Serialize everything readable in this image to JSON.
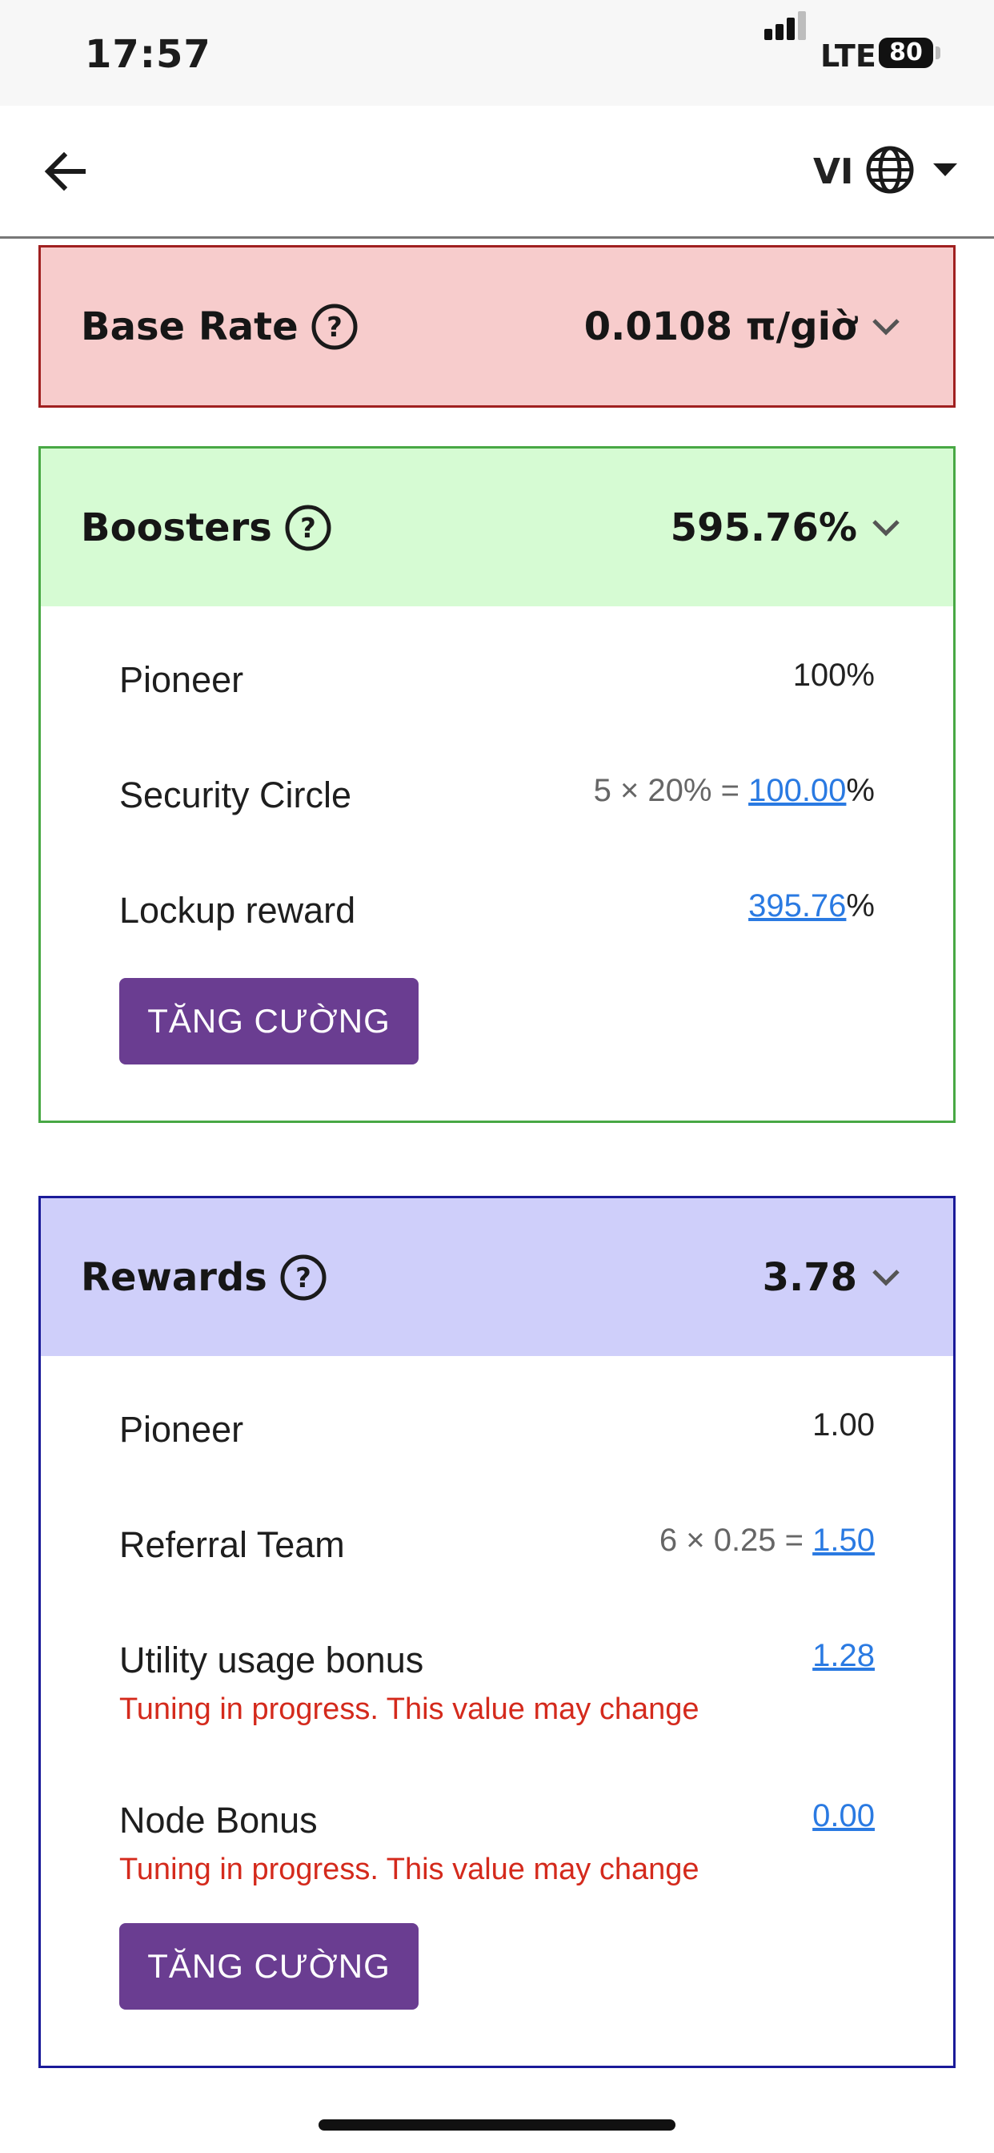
{
  "status_bar": {
    "time": "17:57",
    "network": "LTE",
    "battery": "80"
  },
  "top_nav": {
    "back_icon": "arrow-left-icon",
    "language_code": "VI",
    "language_icon": "globe-icon",
    "dropdown_icon": "caret-down-icon"
  },
  "base_rate": {
    "title": "Base Rate",
    "value": "0.0108 π/giờ",
    "bg_color": "#f7cccc",
    "border_color": "#a02020"
  },
  "boosters": {
    "title": "Boosters",
    "value": "595.76%",
    "bg_color": "#d6fbd3",
    "border_color": "#48a844",
    "rows": [
      {
        "label": "Pioneer",
        "formula": "",
        "link": "",
        "suffix": "100%"
      },
      {
        "label": "Security Circle",
        "formula": "5 × 20% = ",
        "link": "100.00",
        "suffix": "%"
      },
      {
        "label": "Lockup reward",
        "formula": "",
        "link": "395.76",
        "suffix": "%"
      }
    ],
    "button": "TĂNG CƯỜNG"
  },
  "rewards": {
    "title": "Rewards",
    "value": "3.78",
    "bg_color": "#cfcffa",
    "border_color": "#1a1a99",
    "rows": [
      {
        "label": "Pioneer",
        "formula": "",
        "link": "",
        "suffix": "1.00",
        "warning": ""
      },
      {
        "label": "Referral Team",
        "formula": "6 × 0.25 = ",
        "link": "1.50",
        "suffix": "",
        "warning": ""
      },
      {
        "label": "Utility usage bonus",
        "formula": "",
        "link": "1.28",
        "suffix": "",
        "warning": "Tuning in progress. This value may change"
      },
      {
        "label": "Node Bonus",
        "formula": "",
        "link": "0.00",
        "suffix": "",
        "warning": "Tuning in progress. This value may change"
      }
    ],
    "button": "TĂNG CƯỜNG"
  },
  "colors": {
    "accent_button": "#6a3d91",
    "link": "#2a7ae2",
    "warning": "#d42a1c"
  }
}
